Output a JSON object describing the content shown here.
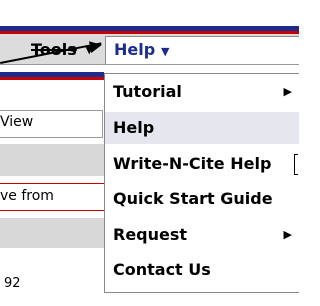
{
  "menubar": {
    "tools_label": "Tools",
    "help_label": "Help"
  },
  "background_page": {
    "view_text": "View",
    "from_text": "ve from",
    "count_text": "92"
  },
  "help_menu": {
    "items": [
      {
        "label": "Tutorial",
        "has_submenu": true
      },
      {
        "label": "Help",
        "has_submenu": false,
        "highlighted": true
      },
      {
        "label": "Write-N-Cite Help",
        "has_submenu": false
      },
      {
        "label": "Quick Start Guide",
        "has_submenu": false
      },
      {
        "label": "Request",
        "has_submenu": true
      },
      {
        "label": "Contact Us",
        "has_submenu": false
      }
    ]
  },
  "icons": {
    "submenu_arrow": "triangle-right-icon",
    "dropdown_caret": "triangle-down-icon"
  },
  "colors": {
    "brand_blue": "#1d2c8a",
    "brand_red": "#c80000",
    "menubar_gray": "#dcdcdc"
  }
}
